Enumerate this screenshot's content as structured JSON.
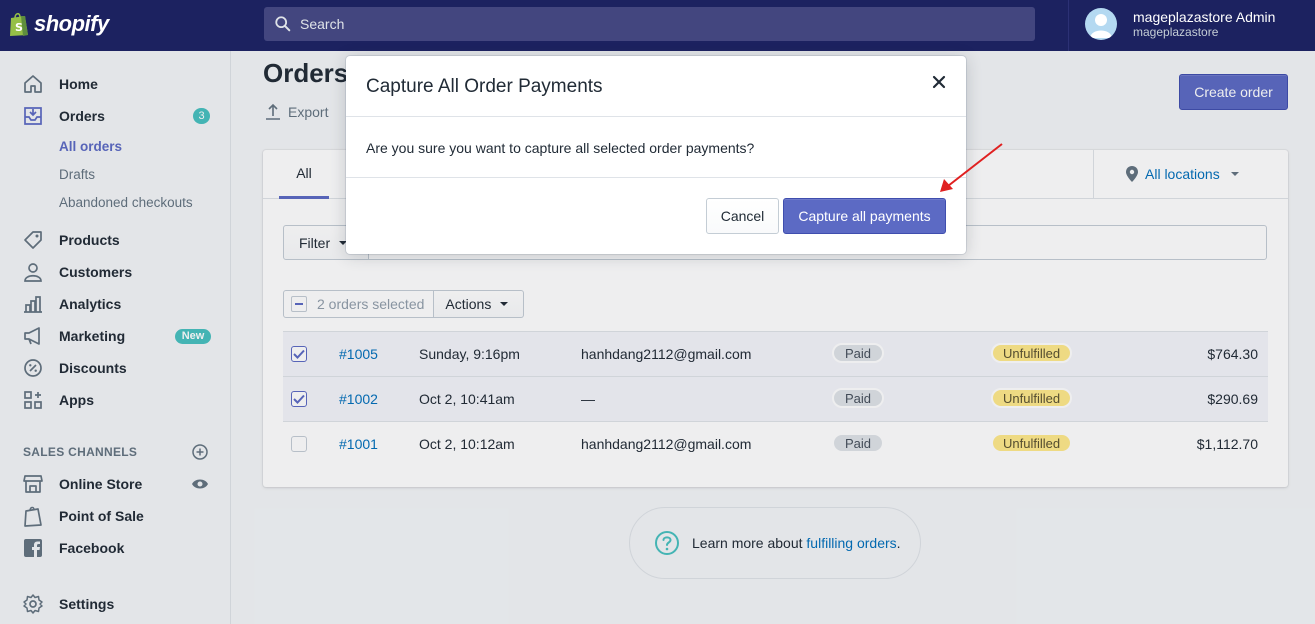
{
  "topbar": {
    "logo_text": "shopify",
    "search_placeholder": "Search",
    "user_name": "mageplazastore Admin",
    "user_store": "mageplazastore"
  },
  "sidebar": {
    "home": "Home",
    "orders": "Orders",
    "orders_badge": "3",
    "all_orders": "All orders",
    "drafts": "Drafts",
    "abandoned": "Abandoned checkouts",
    "products": "Products",
    "customers": "Customers",
    "analytics": "Analytics",
    "marketing": "Marketing",
    "marketing_badge": "New",
    "discounts": "Discounts",
    "apps": "Apps",
    "sales_channels": "SALES CHANNELS",
    "online_store": "Online Store",
    "point_of_sale": "Point of Sale",
    "facebook": "Facebook",
    "settings": "Settings"
  },
  "main": {
    "title": "Orders",
    "export": "Export",
    "create_order": "Create order",
    "tab_all": "All",
    "locations": "All locations",
    "filter": "Filter",
    "selected_count": "2 orders selected",
    "actions": "Actions",
    "learn_prefix": "Learn more about ",
    "learn_link": "fulfilling orders",
    "learn_suffix": "."
  },
  "orders": [
    {
      "id": "#1005",
      "date": "Sunday, 9:16pm",
      "customer": "hanhdang2112@gmail.com",
      "payment": "Paid",
      "fulfillment": "Unfulfilled",
      "total": "$764.30",
      "selected": true
    },
    {
      "id": "#1002",
      "date": "Oct 2, 10:41am",
      "customer": "—",
      "payment": "Paid",
      "fulfillment": "Unfulfilled",
      "total": "$290.69",
      "selected": true
    },
    {
      "id": "#1001",
      "date": "Oct 2, 10:12am",
      "customer": "hanhdang2112@gmail.com",
      "payment": "Paid",
      "fulfillment": "Unfulfilled",
      "total": "$1,112.70",
      "selected": false
    }
  ],
  "modal": {
    "title": "Capture All Order Payments",
    "body": "Are you sure you want to capture all selected order payments?",
    "cancel": "Cancel",
    "confirm": "Capture all payments"
  },
  "colors": {
    "topbar": "#1c2260",
    "primary": "#5c6ac4",
    "link": "#006fbb",
    "badge_teal": "#47c1bf",
    "unfulfilled": "#ffea8a",
    "annotation_arrow": "#e02020"
  }
}
